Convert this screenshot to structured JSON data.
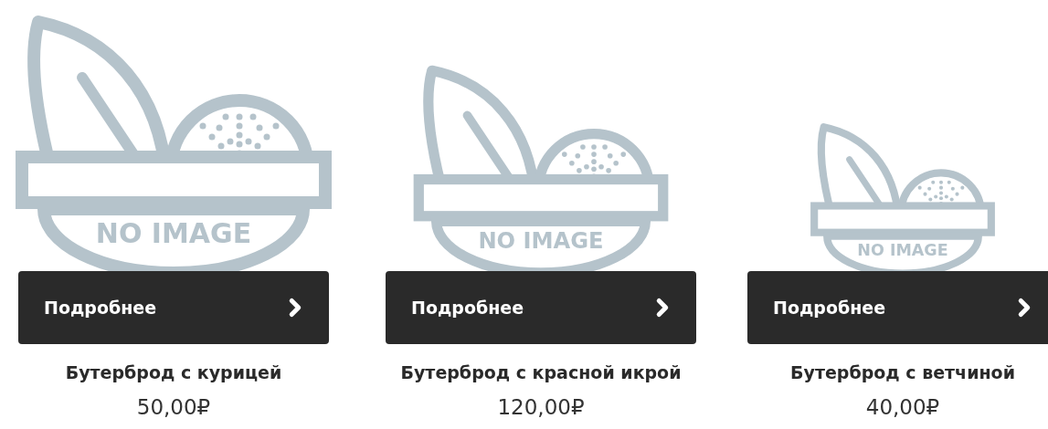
{
  "products": [
    {
      "image_text": "NO IMAGE",
      "button": "Подробнее",
      "title": "Бутерброд с курицей",
      "price": "50,00₽"
    },
    {
      "image_text": "NO IMAGE",
      "button": "Подробнее",
      "title": "Бутерброд с красной икрой",
      "price": "120,00₽"
    },
    {
      "image_text": "NO IMAGE",
      "button": "Подробнее",
      "title": "Бутерброд с ветчиной",
      "price": "40,00₽"
    }
  ]
}
